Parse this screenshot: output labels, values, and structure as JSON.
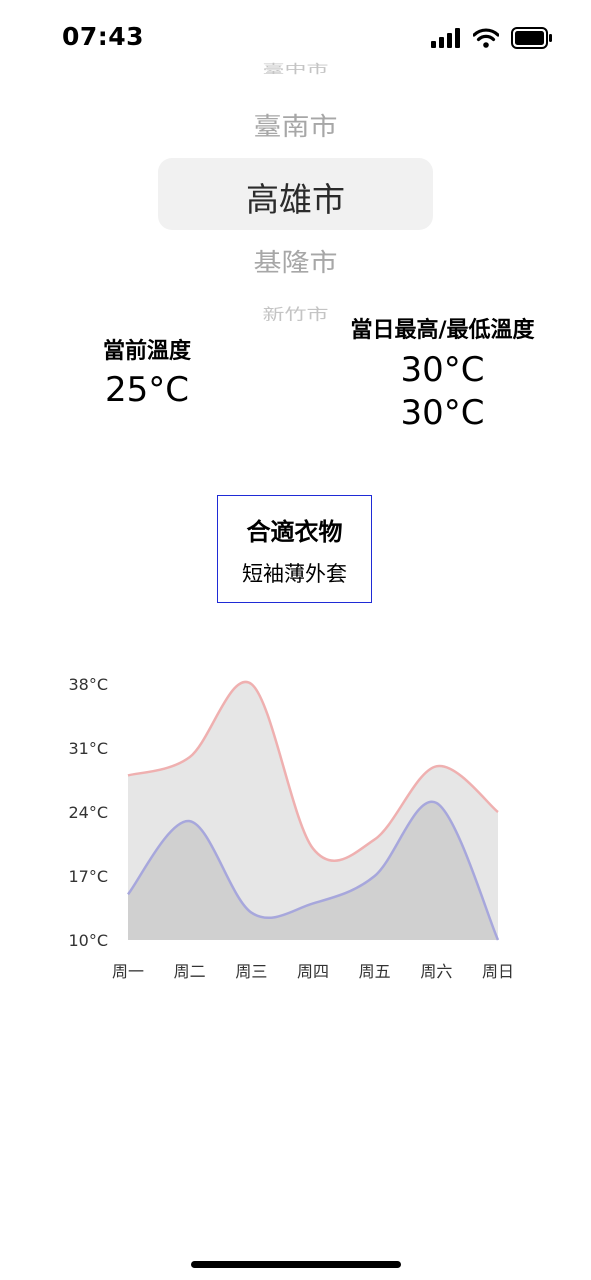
{
  "status_bar": {
    "time": "07:43"
  },
  "city_picker": {
    "options": [
      "臺中市",
      "臺南市",
      "高雄市",
      "基隆市",
      "新竹市"
    ],
    "selected": "高雄市"
  },
  "current": {
    "label": "當前溫度",
    "temp": "25°C"
  },
  "daily": {
    "label": "當日最高/最低溫度",
    "high": "30°C",
    "low": "30°C"
  },
  "clothing": {
    "title": "合適衣物",
    "value": "短袖薄外套"
  },
  "chart_data": {
    "type": "area",
    "categories": [
      "周一",
      "周二",
      "周三",
      "周四",
      "周五",
      "周六",
      "周日"
    ],
    "y_tick_labels": [
      "38°C",
      "31°C",
      "24°C",
      "17°C",
      "10°C"
    ],
    "ylim": [
      10,
      38
    ],
    "series": [
      {
        "values": [
          28,
          30,
          38,
          20,
          21,
          29,
          24
        ],
        "color": "#efb0b0"
      },
      {
        "values": [
          15,
          23,
          13,
          14,
          17,
          25,
          10
        ],
        "color": "#a7a7dc"
      }
    ],
    "fill_upper": "#e6e6e6",
    "fill_lower": "#d0d0d0"
  }
}
